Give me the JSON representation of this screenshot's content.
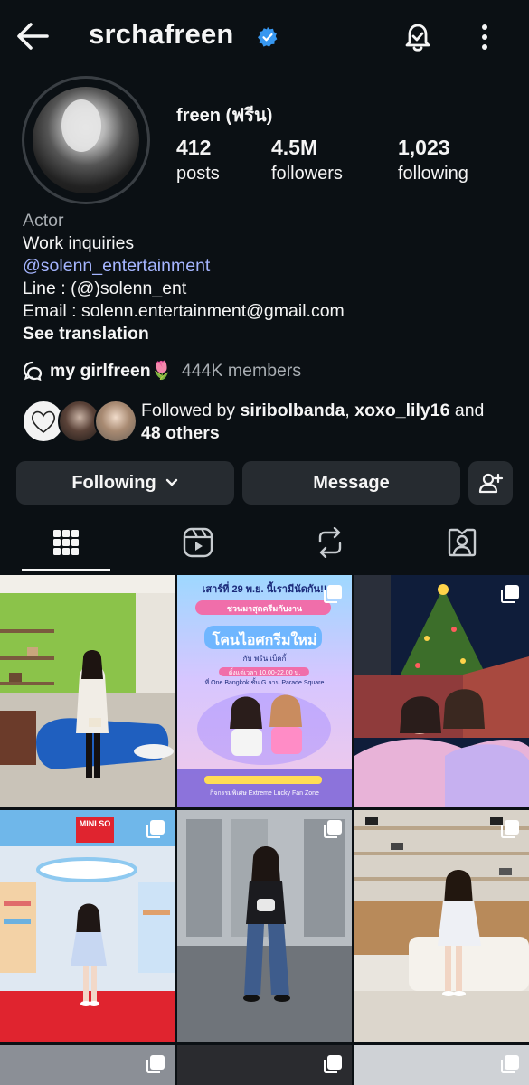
{
  "header": {
    "username": "srchafreen",
    "icons": [
      "back-arrow-icon",
      "verified-badge-icon",
      "notification-bell-icon",
      "more-options-icon"
    ]
  },
  "profile": {
    "display_name": "freen (ฟรีน)",
    "stats": {
      "posts_count": "412",
      "posts_label": "posts",
      "followers_count": "4.5M",
      "followers_label": "followers",
      "following_count": "1,023",
      "following_label": "following"
    },
    "bio": {
      "category": "Actor",
      "line1": "Work inquiries",
      "link": "@solenn_entertainment",
      "line3": "Line : (@)solenn_ent",
      "line4": "Email : solenn.entertainment@gmail.com",
      "see_translation": "See translation"
    },
    "channel": {
      "name": "my girlfreen🌷",
      "members": "444K members"
    },
    "followed_by": {
      "prefix": "Followed by",
      "user1": "siribolbanda",
      "sep": ",",
      "user2": "xoxo_lily16",
      "and": "and",
      "others": "48 others"
    }
  },
  "actions": {
    "following_label": "Following",
    "message_label": "Message"
  },
  "tabs": [
    "grid-icon",
    "reels-icon",
    "reposts-icon",
    "tagged-icon"
  ],
  "colors": {
    "background": "#0b1014",
    "button": "#262b30",
    "verified": "#3797f0",
    "link": "#a5b5ff",
    "muted": "#a8adb2"
  },
  "grid_posts": [
    {
      "text": ""
    },
    {
      "text_main": "เสาร์ที่ 29 พ.ย. นี้เรามีนัดกัน!!",
      "text_sub": "ชวนมาสุดครีมกับงาน",
      "title": "โคนไอศกรีมใหม่",
      "names": "กับ ฟรีน เบ็คกี้",
      "venue": "ที่ One Bangkok ชั้น G ลาน Parade Square",
      "time": "ตั้งแต่เวลา 10.00-22.00 น.",
      "foot": "กิจกรรมพิเศษ Extreme Lucky Fan Zone"
    },
    {
      "text": ""
    },
    {
      "store": "MINI SO"
    },
    {
      "text": ""
    },
    {
      "text": ""
    }
  ]
}
